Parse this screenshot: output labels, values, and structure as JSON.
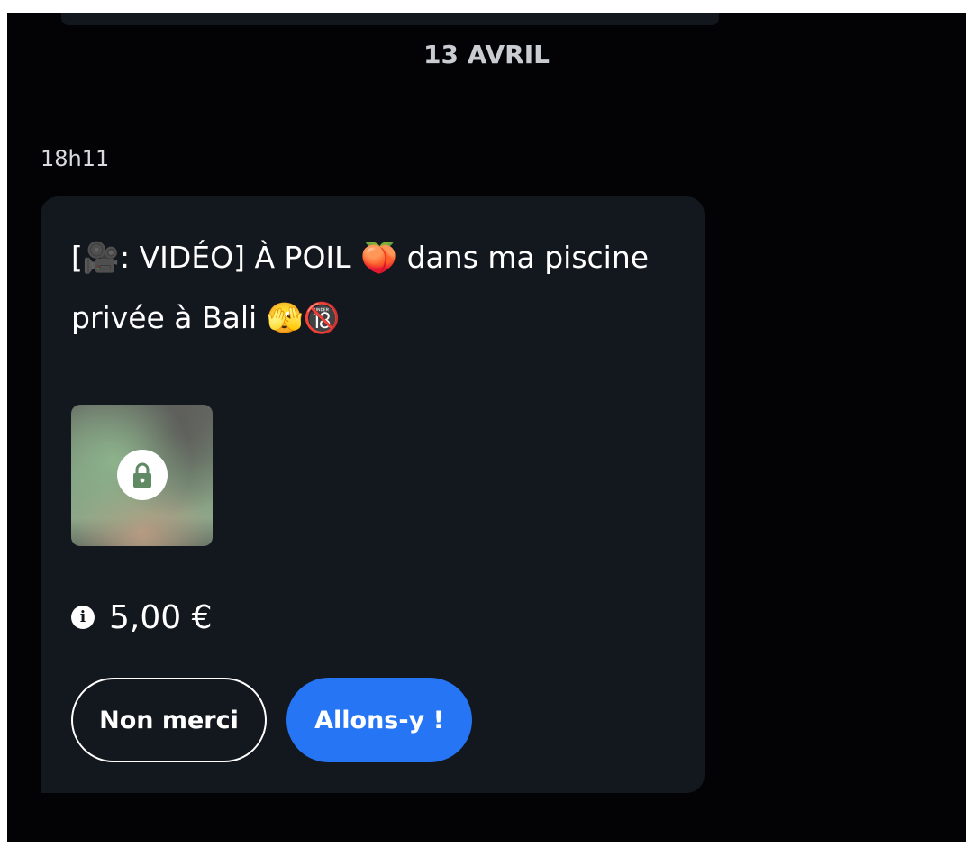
{
  "date_separator": "13 AVRIL",
  "message": {
    "time": "18h11",
    "text_line1": "[🎥: VIDÉO] À POIL 🍑 dans ma piscine",
    "text_line2": "privée à Bali 🫣🔞",
    "media": {
      "locked": true,
      "icon": "lock-icon"
    },
    "price": "5,00 €",
    "info_icon": "info-icon",
    "buttons": {
      "decline_label": "Non merci",
      "accept_label": "Allons-y !"
    }
  },
  "colors": {
    "background": "#030306",
    "card": "#13171e",
    "accent": "#2575f5",
    "text": "#ffffff"
  }
}
